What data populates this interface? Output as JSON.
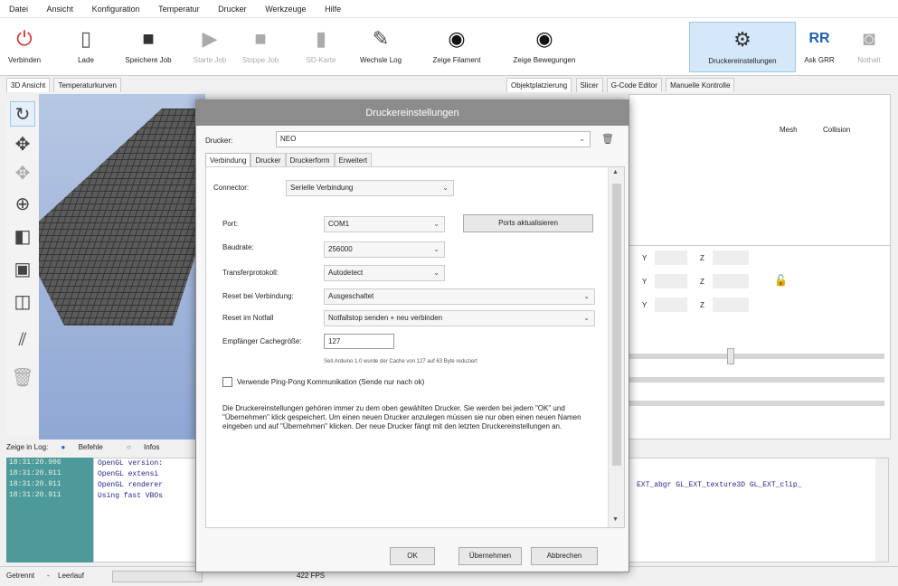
{
  "menu": [
    "Datei",
    "Ansicht",
    "Konfiguration",
    "Temperatur",
    "Drucker",
    "Werkzeuge",
    "Hilfe"
  ],
  "toolbar": {
    "connect": "Verbinden",
    "load": "Lade",
    "save_job": "Speichere Job",
    "start_job": "Starte Job",
    "stop_job": "Stoppe Job",
    "sd_card": "SD-Karte",
    "clear_log": "Wechsle Log",
    "show_filament": "Zeige Filament",
    "show_moves": "Zeige Bewegungen",
    "printer_settings": "Druckereinstellungen",
    "ask_grr": "Ask GRR",
    "emergency": "Nothalt"
  },
  "view_tabs": [
    "3D Ansicht",
    "Temperaturkurven"
  ],
  "right_tabs": [
    "Objektplatzierung",
    "Slicer",
    "G-Code Editor",
    "Manuelle Kontrolle"
  ],
  "object_table": {
    "columns": [
      "Mesh",
      "Collision"
    ]
  },
  "coord_labels": {
    "y": "Y",
    "z": "Z"
  },
  "log": {
    "tabs": [
      "Zeige in Log:",
      "Befehle",
      "Infos"
    ],
    "times": [
      "18:31:20.906",
      "18:31:20.911",
      "18:31:20.911",
      "18:31:20.911"
    ],
    "messages": [
      "OpenGL version:",
      "OpenGL extensi",
      "OpenGL renderer",
      "Using fast VBOs"
    ],
    "right_text": "EXT_abgr GL_EXT_texture3D GL_EXT_clip_"
  },
  "status": {
    "connection": "Getrennt",
    "idle": "Leerlauf",
    "fps": "422 FPS"
  },
  "dialog": {
    "title": "Druckereinstellungen",
    "printer_label": "Drucker:",
    "printer_value": "NEO",
    "tabs": [
      "Verbindung",
      "Drucker",
      "Druckerform",
      "Erweitert"
    ],
    "connector_label": "Connector:",
    "connector_value": "Serielle Verbindung",
    "port_label": "Port:",
    "port_value": "COM1",
    "refresh_ports": "Ports aktualisieren",
    "baud_label": "Baudrate:",
    "baud_value": "256000",
    "protocol_label": "Transferprotokoll:",
    "protocol_value": "Autodetect",
    "reset_connect_label": "Reset bei Verbindung:",
    "reset_connect_value": "Ausgeschaltet",
    "reset_emergency_label": "Reset im Notfall",
    "reset_emergency_value": "Notfallstop senden + neu verbinden",
    "cache_label": "Empfänger Cachegröße:",
    "cache_value": "127",
    "cache_note": "Seit Arduino 1.0 wurde der Cache von 127 auf 63 Byte reduziert",
    "pingpong_label": "Verwende Ping-Pong Kommunikation (Sende nur nach ok)",
    "info_text": "Die Druckereinstellungen gehören immer zu dem oben gewählten Drucker. Sie werden bei jedem \"OK\" und \"Übernehmen\" klick gespeichert. Um einen neuen Drucker anzulegen müssen sie nur oben einen neuen Namen eingeben und auf \"Übernehmen\" klicken. Der neue Drucker fängt mit den letzten Druckereinstellungen an.",
    "ok": "OK",
    "apply": "Übernehmen",
    "cancel": "Abbrechen"
  }
}
